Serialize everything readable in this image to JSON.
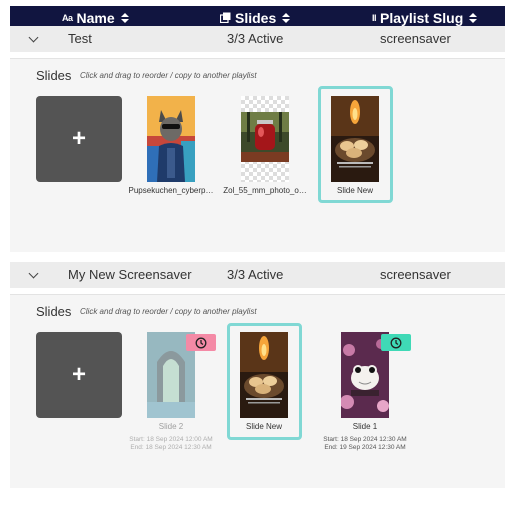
{
  "header": {
    "name_icon": "Aa",
    "name_label": "Name",
    "slides_icon": "stack-icon",
    "slides_label": "Slides",
    "slug_icon": "II",
    "slug_label": "Playlist Slug",
    "background": "#111540"
  },
  "groups": [
    {
      "name": "Test",
      "status": "3/3 Active",
      "slug": "screensaver",
      "slides_label": "Slides",
      "hint": "Click and drag to reorder / copy to another playlist",
      "add_label": "+",
      "slides": [
        {
          "caption": "Pupsekuchen_cyberp…"
        },
        {
          "caption": "Zol_55_mm_photo_o…"
        },
        {
          "caption": "Slide New",
          "selected": true
        }
      ]
    },
    {
      "name": "My New Screensaver",
      "status": "3/3 Active",
      "slug": "screensaver",
      "slides_label": "Slides",
      "hint": "Click and drag to reorder / copy to another playlist",
      "add_label": "+",
      "slides": [
        {
          "caption": "Slide 2",
          "start": "Start: 18 Sep 2024 12:00 AM",
          "end": "End: 18 Sep 2024 12:30 AM",
          "badge_color": "#f48aa6",
          "inactive": true
        },
        {
          "caption": "Slide New",
          "selected": true
        },
        {
          "caption": "Slide 1",
          "start": "Start: 18 Sep 2024 12:30 AM",
          "end": "End: 19 Sep 2024 12:30 AM",
          "badge_color": "#3fd9b6"
        }
      ]
    }
  ],
  "colors": {
    "selection": "#80d8d4",
    "add_button": "#545454"
  }
}
